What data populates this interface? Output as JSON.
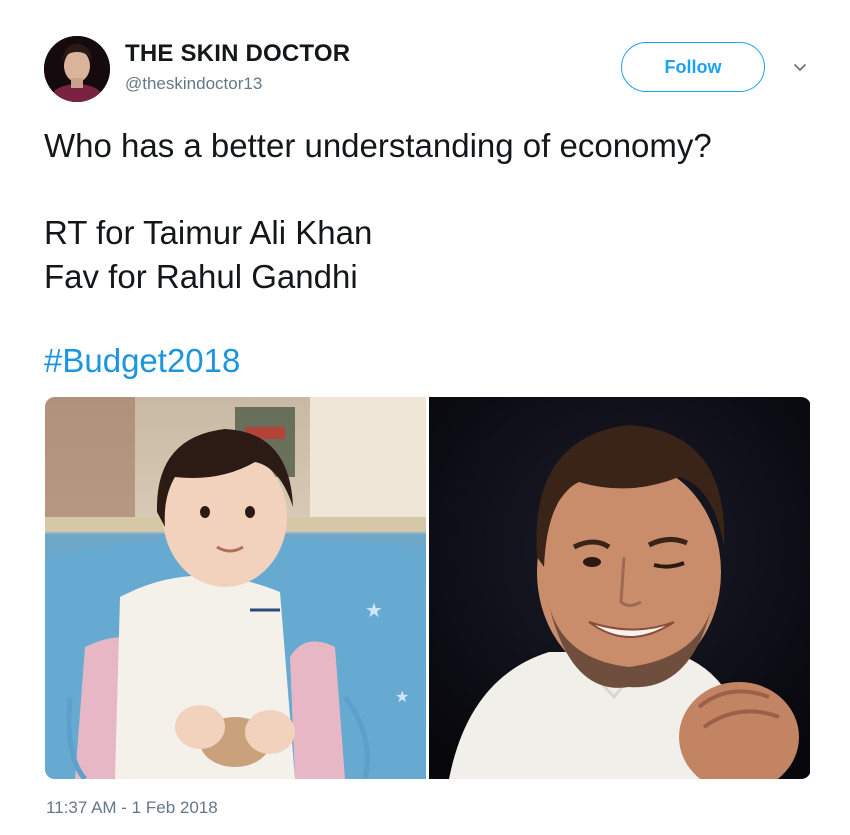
{
  "user": {
    "display_name": "THE SKIN DOCTOR",
    "handle": "@theskindoctor13"
  },
  "actions": {
    "follow_label": "Follow",
    "more_icon": "chevron-down-icon"
  },
  "tweet": {
    "lines": [
      "Who has a better understanding of economy?",
      "RT for Taimur Ali Khan",
      "Fav for Rahul Gandhi"
    ],
    "hashtag": "#Budget2018",
    "timestamp": "11:37 AM - 1 Feb 2018"
  },
  "colors": {
    "accent": "#1da1f2",
    "hashtag": "#1b95e0",
    "secondary_text": "#657786"
  }
}
